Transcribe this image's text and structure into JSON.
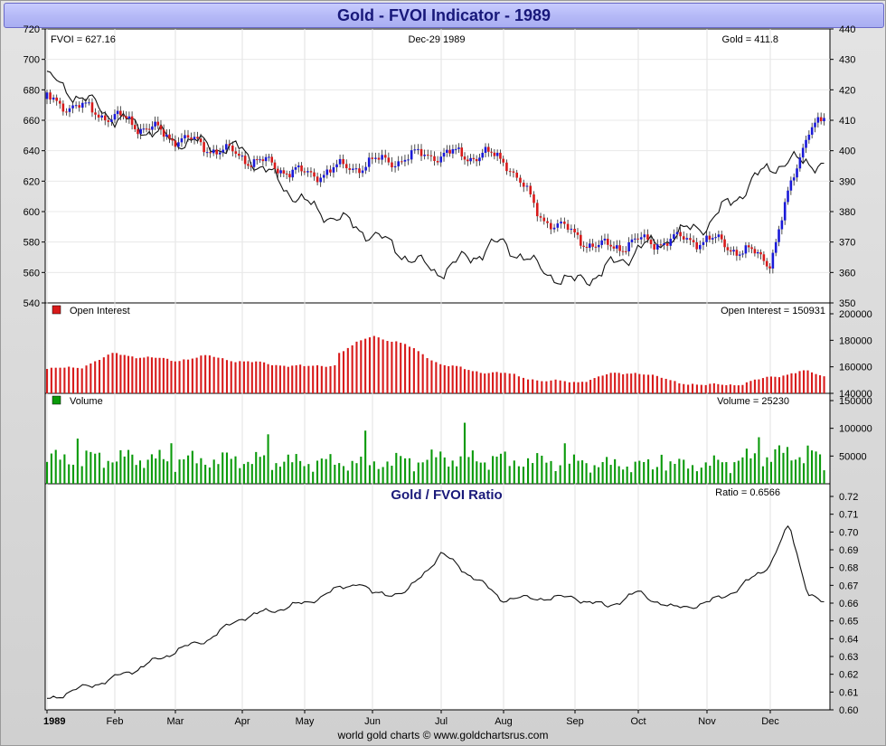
{
  "window": {
    "title": "Gold - FVOI Indicator - 1989"
  },
  "footer": "world gold charts © www.goldchartsrus.com",
  "colors": {
    "up": "#1a1ad8",
    "down": "#d81a1a",
    "oi": "#d81a1a",
    "volume": "#0a9a0a",
    "line": "#111111",
    "panel_title": "#1a1a7a"
  },
  "chart_data": [
    {
      "panel": "price",
      "type": "line",
      "labels": {
        "left": "FVOI = 627.16",
        "center": "Dec-29  1989",
        "right": "Gold = 411.8"
      },
      "left_axis": {
        "range": [
          540,
          720
        ],
        "ticks": [
          "540",
          "560",
          "580",
          "600",
          "620",
          "640",
          "660",
          "680",
          "700",
          "720"
        ]
      },
      "right_axis": {
        "range": [
          350,
          440
        ],
        "ticks": [
          "350",
          "360",
          "370",
          "380",
          "390",
          "400",
          "410",
          "420",
          "430",
          "440"
        ]
      },
      "series": [
        {
          "name": "Gold",
          "axis": "right",
          "style": "candles",
          "x": [
            0,
            1,
            1.9,
            3,
            4,
            5,
            5.9,
            7,
            7.5,
            8,
            8.4,
            9,
            10,
            11,
            11.6,
            12
          ],
          "values": [
            417,
            411,
            405,
            398,
            392,
            396,
            399,
            398,
            379,
            372,
            368,
            370,
            371,
            364,
            408,
            410
          ]
        },
        {
          "name": "FVOI",
          "axis": "left",
          "style": "line",
          "x": [
            0,
            1,
            1.9,
            3,
            4,
            5,
            5.9,
            7,
            7.5,
            8,
            8.4,
            9,
            10,
            11,
            11.6,
            12
          ],
          "values": [
            688,
            662,
            648,
            640,
            605,
            585,
            560,
            580,
            562,
            553,
            560,
            575,
            592,
            630,
            634,
            626
          ]
        }
      ]
    },
    {
      "panel": "open_interest",
      "type": "bar",
      "labels": {
        "legend": "Open Interest",
        "right": "Open Interest = 150931"
      },
      "right_axis": {
        "range": [
          140000,
          200000
        ],
        "ticks": [
          "140000",
          "160000",
          "180000",
          "200000"
        ]
      },
      "series": [
        {
          "name": "Open Interest",
          "x": [
            0,
            0.5,
            1,
            1.5,
            2,
            2.5,
            3,
            3.5,
            4,
            4.5,
            4.5,
            5,
            5.5,
            6,
            6.5,
            7,
            7.5,
            8,
            8.5,
            9,
            9.5,
            10,
            10.5,
            11,
            11.5,
            12
          ],
          "values": [
            158000,
            160000,
            170000,
            167000,
            165000,
            168000,
            164000,
            162000,
            160000,
            162000,
            170000,
            184000,
            176000,
            162000,
            157000,
            155000,
            150000,
            148000,
            154000,
            156000,
            149000,
            146000,
            147000,
            152000,
            157000,
            151000
          ]
        }
      ]
    },
    {
      "panel": "volume",
      "type": "bar",
      "labels": {
        "legend": "Volume",
        "right": "Volume = 25230"
      },
      "right_axis": {
        "range": [
          0,
          150000
        ],
        "ticks": [
          "50000",
          "100000",
          "150000"
        ]
      },
      "series": [
        {
          "name": "Volume",
          "x": [
            0,
            1,
            2,
            3,
            4,
            5,
            6,
            7,
            8,
            9,
            10,
            11,
            11.6,
            12
          ],
          "values": [
            45000,
            48000,
            43000,
            44000,
            40000,
            38000,
            47000,
            44000,
            38000,
            34000,
            35000,
            52000,
            56000,
            28000
          ]
        }
      ]
    },
    {
      "panel": "ratio",
      "type": "line",
      "labels": {
        "title": "Gold / FVOI Ratio",
        "right": "Ratio = 0.6566"
      },
      "right_axis": {
        "range": [
          0.6,
          0.72
        ],
        "ticks": [
          "0.60",
          "0.61",
          "0.62",
          "0.63",
          "0.64",
          "0.65",
          "0.66",
          "0.67",
          "0.68",
          "0.69",
          "0.70",
          "0.71",
          "0.72"
        ]
      },
      "series": [
        {
          "name": "Gold / FVOI Ratio",
          "x": [
            0,
            0.5,
            1,
            1.5,
            2,
            2.5,
            3,
            3.5,
            4,
            4.5,
            4.8,
            5,
            5.5,
            6,
            6.5,
            7,
            7.5,
            8,
            8.5,
            9,
            9.5,
            10,
            10.5,
            11,
            11.3,
            11.6,
            12
          ],
          "values": [
            0.606,
            0.612,
            0.618,
            0.625,
            0.633,
            0.64,
            0.652,
            0.656,
            0.66,
            0.668,
            0.672,
            0.665,
            0.666,
            0.688,
            0.675,
            0.662,
            0.663,
            0.663,
            0.658,
            0.666,
            0.657,
            0.66,
            0.668,
            0.682,
            0.704,
            0.665,
            0.656
          ]
        }
      ]
    }
  ],
  "x_axis": {
    "labels": [
      "1989",
      "Feb",
      "Mar",
      "Apr",
      "May",
      "Jun",
      "Jul",
      "Aug",
      "Sep",
      "Oct",
      "Nov",
      "Dec"
    ]
  }
}
